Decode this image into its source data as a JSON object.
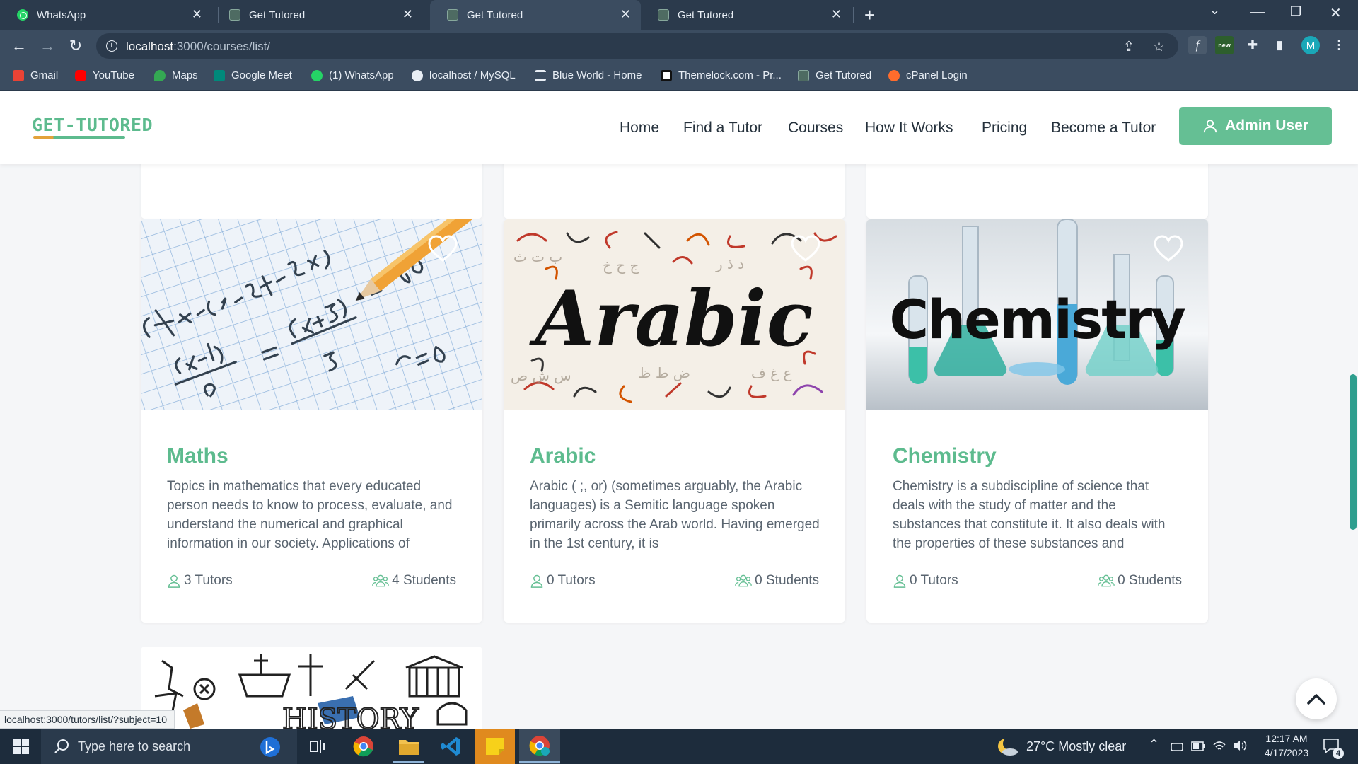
{
  "browser": {
    "tabs": [
      {
        "title": "WhatsApp",
        "favicon": "whatsapp-icon",
        "active": false
      },
      {
        "title": "Get Tutored",
        "favicon": "get-tutored-icon",
        "active": false
      },
      {
        "title": "Get Tutored",
        "favicon": "get-tutored-icon",
        "active": true
      },
      {
        "title": "Get Tutored",
        "favicon": "get-tutored-icon",
        "active": false
      }
    ],
    "url_host": "localhost",
    "url_path": ":3000/courses/list/",
    "ext_cpk_label": "new",
    "profile_initial": "M",
    "bookmarks": [
      {
        "label": "Gmail",
        "icon": "gmail-icon",
        "color": "#ea4335"
      },
      {
        "label": "YouTube",
        "icon": "youtube-icon",
        "color": "#ff0000"
      },
      {
        "label": "Maps",
        "icon": "maps-icon",
        "color": "#34a853"
      },
      {
        "label": "Google Meet",
        "icon": "meet-icon",
        "color": "#00897b"
      },
      {
        "label": "(1) WhatsApp",
        "icon": "whatsapp-icon",
        "color": "#25d366"
      },
      {
        "label": "localhost / MySQL",
        "icon": "globe-icon",
        "color": "#e8eef5"
      },
      {
        "label": "Blue World - Home",
        "icon": "layers-icon",
        "color": "#e8eef5"
      },
      {
        "label": "Themelock.com - Pr...",
        "icon": "themelock-icon",
        "color": "#ffffff"
      },
      {
        "label": "Get Tutored",
        "icon": "get-tutored-icon",
        "color": "#4e6b62"
      },
      {
        "label": "cPanel Login",
        "icon": "cpanel-icon",
        "color": "#ff6c2c"
      }
    ],
    "status_url": "localhost:3000/tutors/list/?subject=10"
  },
  "site": {
    "logo": "GET-TUTORED",
    "nav": [
      "Home",
      "Find a Tutor",
      "Courses",
      "How It Works",
      "Pricing",
      "Become a Tutor"
    ],
    "admin_button": "Admin User",
    "accent_color": "#5dbb8e"
  },
  "courses": [
    {
      "title": "Maths",
      "description": "Topics in mathematics that every educated person needs to know to process, evaluate, and understand the numerical and graphical information in our society. Applications of",
      "tutors": "3 Tutors",
      "students": "4 Students",
      "image": "maths-equations-image"
    },
    {
      "title": "Arabic",
      "description": "Arabic ( ;, or) (sometimes arguably, the Arabic languages) is a Semitic language spoken primarily across the Arab world. Having emerged in the 1st century, it is",
      "tutors": "0 Tutors",
      "students": "0 Students",
      "image": "arabic-calligraphy-image",
      "image_text": "Arabic"
    },
    {
      "title": "Chemistry",
      "description": "Chemistry is a subdiscipline of science that deals with the study of matter and the substances that constitute it. It also deals with the properties of these substances and",
      "tutors": "0 Tutors",
      "students": "0 Students",
      "image": "chemistry-flasks-image",
      "image_text": "Chemistry"
    }
  ],
  "history_card": {
    "image": "history-collage-image",
    "image_text": "HISTORY"
  },
  "taskbar": {
    "search_placeholder": "Type here to search",
    "weather": "27°C  Mostly clear",
    "time": "12:17 AM",
    "date": "4/17/2023",
    "notification_count": "4"
  }
}
